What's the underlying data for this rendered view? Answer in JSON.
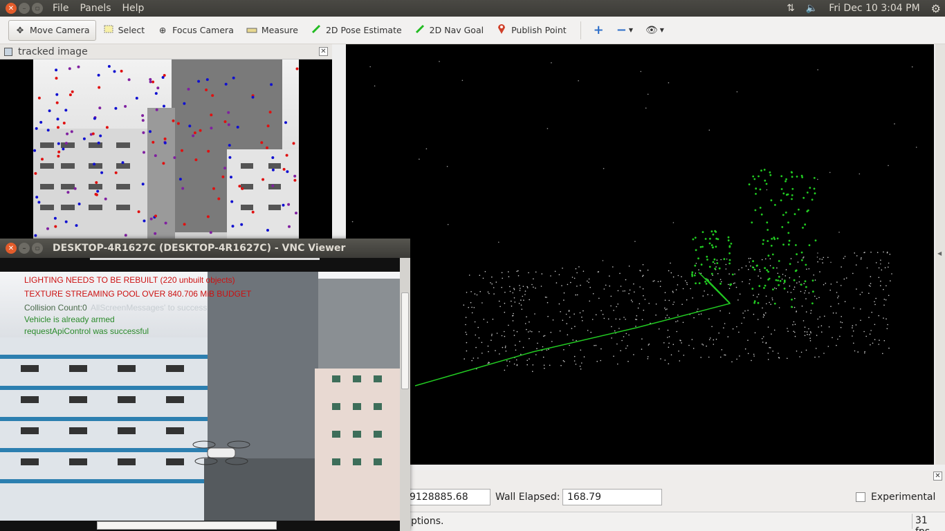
{
  "topbar": {
    "menu": [
      "File",
      "Panels",
      "Help"
    ],
    "datetime": "Fri Dec 10  3:04 PM",
    "icons": [
      "network-icon",
      "volume-icon",
      "settings-gear-icon"
    ]
  },
  "toolbar": {
    "tools": [
      {
        "label": "Move Camera",
        "icon": "move-camera-icon",
        "active": true
      },
      {
        "label": "Select",
        "icon": "select-icon",
        "active": false
      },
      {
        "label": "Focus Camera",
        "icon": "focus-camera-icon",
        "active": false
      },
      {
        "label": "Measure",
        "icon": "measure-icon",
        "active": false
      },
      {
        "label": "2D Pose Estimate",
        "icon": "pose-estimate-icon",
        "active": false
      },
      {
        "label": "2D Nav Goal",
        "icon": "nav-goal-icon",
        "active": false
      },
      {
        "label": "Publish Point",
        "icon": "publish-point-icon",
        "active": false
      }
    ]
  },
  "tracked_panel": {
    "title": "tracked image"
  },
  "vnc": {
    "title": "DESKTOP-4R1627C (DESKTOP-4R1627C) - VNC Viewer",
    "messages": {
      "line1": "LIGHTING NEEDS TO BE REBUILT (220 unbuilt objects)",
      "line2": "TEXTURE STREAMING POOL OVER 840.706 MiB BUDGET",
      "line3": "Collision Count:0",
      "line3_ghost": "AllScreenMessages' to success",
      "line4": "Vehicle is already armed",
      "line5": "requestApiControl was successful"
    }
  },
  "time_panel": {
    "ros_time_value": "9128885.68",
    "wall_elapsed_label": "Wall Elapsed:",
    "wall_elapsed_value": "168.79",
    "experimental_label": "Experimental",
    "status_text": "ptions.",
    "fps": "31 fps"
  },
  "colors": {
    "trajectory": "#22cc22",
    "feature_red": "#e01010",
    "feature_blue": "#1010d0",
    "feature_purple": "#8020a0"
  }
}
